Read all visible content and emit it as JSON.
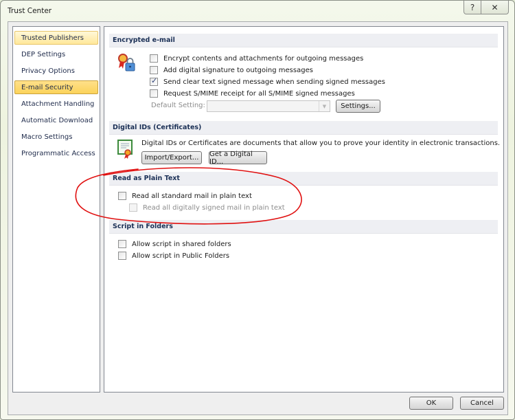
{
  "window": {
    "title": "Trust Center",
    "help_glyph": "?",
    "close_glyph": "✕"
  },
  "nav": {
    "items": [
      {
        "label": "Trusted Publishers",
        "state": "hover"
      },
      {
        "label": "DEP Settings",
        "state": "normal"
      },
      {
        "label": "Privacy Options",
        "state": "normal"
      },
      {
        "label": "E-mail Security",
        "state": "selected"
      },
      {
        "label": "Attachment Handling",
        "state": "normal"
      },
      {
        "label": "Automatic Download",
        "state": "normal"
      },
      {
        "label": "Macro Settings",
        "state": "normal"
      },
      {
        "label": "Programmatic Access",
        "state": "normal"
      }
    ]
  },
  "sections": {
    "encrypted": {
      "header": "Encrypted e-mail",
      "icon": "certificate-lock-icon",
      "options": [
        {
          "label": "Encrypt contents and attachments for outgoing messages",
          "checked": false
        },
        {
          "label": "Add digital signature to outgoing messages",
          "checked": false
        },
        {
          "label": "Send clear text signed message when sending signed messages",
          "checked": true
        },
        {
          "label": "Request S/MIME receipt for all S/MIME signed messages",
          "checked": false
        }
      ],
      "default_setting_label": "Default Setting:",
      "default_setting_value": "",
      "settings_button": "Settings..."
    },
    "digital_ids": {
      "header": "Digital IDs (Certificates)",
      "icon": "certificate-icon",
      "description": "Digital IDs or Certificates are documents that allow you to prove your identity in electronic transactions.",
      "import_export_button": "Import/Export...",
      "get_id_button": "Get a Digital ID..."
    },
    "plain_text": {
      "header": "Read as Plain Text",
      "options": [
        {
          "label": "Read all standard mail in plain text",
          "checked": false,
          "disabled": false
        },
        {
          "label": "Read all digitally signed mail in plain text",
          "checked": false,
          "disabled": true
        }
      ]
    },
    "script": {
      "header": "Script in Folders",
      "options": [
        {
          "label": "Allow script in shared folders",
          "checked": false
        },
        {
          "label": "Allow script in Public Folders",
          "checked": false
        }
      ]
    }
  },
  "footer": {
    "ok": "OK",
    "cancel": "Cancel"
  },
  "annotation": {
    "type": "hand-drawn ellipse",
    "color": "#e01010",
    "encloses": "Read as Plain Text"
  }
}
